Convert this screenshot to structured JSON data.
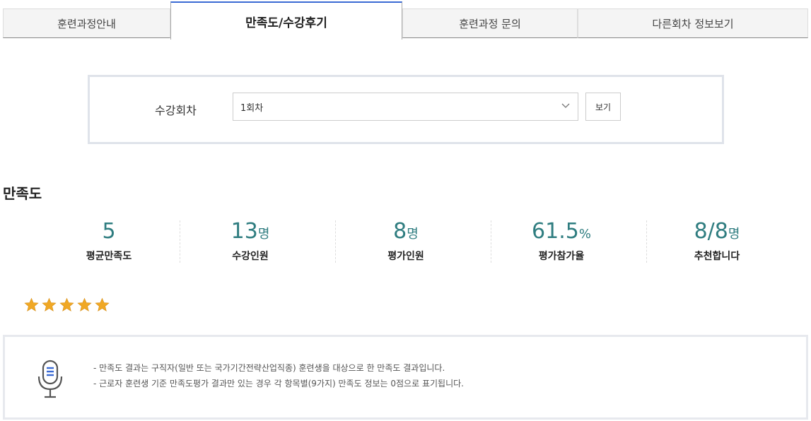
{
  "tabs": [
    {
      "label": "훈련과정안내",
      "active": false
    },
    {
      "label": "만족도/수강후기",
      "active": true
    },
    {
      "label": "훈련과정 문의",
      "active": false
    },
    {
      "label": "다른회차 정보보기",
      "active": false
    }
  ],
  "session_select": {
    "label": "수강회차",
    "value": "1회차",
    "button_label": "보기",
    "chevron_icon": "chevron-down-icon"
  },
  "satisfaction": {
    "title": "만족도",
    "stats": [
      {
        "value": "5",
        "unit": "",
        "label": "평균만족도"
      },
      {
        "value": "13",
        "unit": "명",
        "label": "수강인원"
      },
      {
        "value": "8",
        "unit": "명",
        "label": "평가인원"
      },
      {
        "value": "61.5",
        "unit": "%",
        "label": "평가참가율"
      },
      {
        "value": "8/8",
        "unit": "명",
        "label": "추천합니다"
      }
    ],
    "rating_stars": 5,
    "star_color": "#f0a825",
    "accent_color": "#2f7d80"
  },
  "notice": {
    "icon": "microphone-icon",
    "lines": [
      "- 만족도 결과는 구직자(일반 또는 국가기간전략산업직종) 훈련생을 대상으로 한 만족도 결과입니다.",
      "- 근로자 훈련생 기준 만족도평가 결과만 있는 경우 각 항목별(9가지) 만족도 정보는 0점으로 표기됩니다."
    ]
  }
}
